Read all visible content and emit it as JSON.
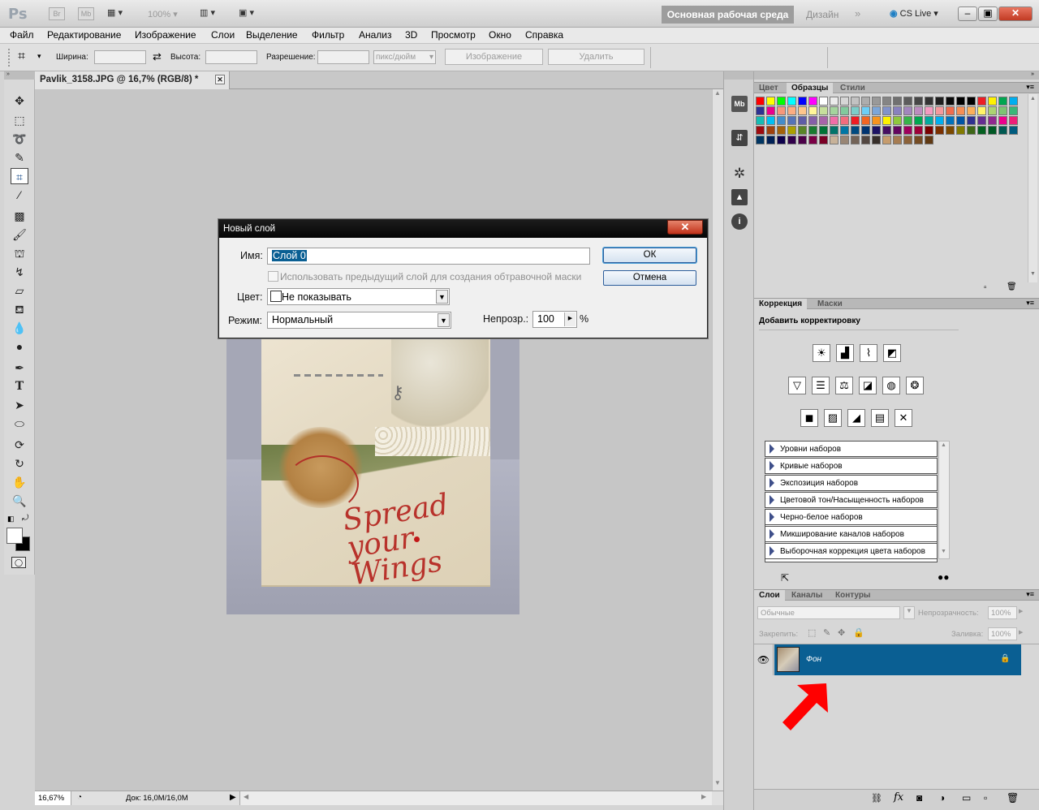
{
  "app": {
    "logo": "Ps",
    "bridge": "Br",
    "mini_bridge": "Mb",
    "zoom": "100%",
    "workspace": "Основная рабочая среда",
    "design": "Дизайн",
    "cs_live": "CS Live"
  },
  "menu": [
    "Файл",
    "Редактирование",
    "Изображение",
    "Слои",
    "Выделение",
    "Фильтр",
    "Анализ",
    "3D",
    "Просмотр",
    "Окно",
    "Справка"
  ],
  "options": {
    "width_label": "Ширина:",
    "height_label": "Высота:",
    "resolution_label": "Разрешение:",
    "unit": "пикс/дюйм",
    "image_button": "Изображение",
    "delete_button": "Удалить"
  },
  "document": {
    "tab_title": "Pavlik_3158.JPG @ 16,7% (RGB/8) *",
    "zoom_value": "16,67%",
    "doc_info": "Док: 16,0M/16,0M"
  },
  "dialog": {
    "title": "Новый слой",
    "name_label": "Имя:",
    "name_value": "Слой 0",
    "clip_mask_label": "Использовать предыдущий слой для создания обтравочной маски",
    "color_label": "Цвет:",
    "color_value": "Не показывать",
    "mode_label": "Режим:",
    "mode_value": "Нормальный",
    "opacity_label": "Непрозр.:",
    "opacity_value": "100",
    "opacity_unit": "%",
    "ok": "ОК",
    "cancel": "Отмена"
  },
  "swatches_panel": {
    "tabs": [
      "Цвет",
      "Образцы",
      "Стили"
    ],
    "colors": [
      "#ff0000",
      "#ffff00",
      "#00ff00",
      "#00ffff",
      "#0000ff",
      "#ff00ff",
      "#ffffff",
      "#ebebeb",
      "#d6d6d6",
      "#c2c2c2",
      "#adadad",
      "#999999",
      "#858585",
      "#707070",
      "#5c5c5c",
      "#474747",
      "#333333",
      "#1f1f1f",
      "#0a0a0a",
      "#000000",
      "#000000",
      "#ee1d24",
      "#fff200",
      "#00a650",
      "#00aeef",
      "#2e3192",
      "#ec008c",
      "#f7977a",
      "#fbad82",
      "#fdc68c",
      "#fff799",
      "#c6df9c",
      "#a4d49d",
      "#81ca9d",
      "#7bcdc9",
      "#6ccff7",
      "#7ca6d8",
      "#8293ca",
      "#8881be",
      "#a286bd",
      "#bc8cbf",
      "#f49bc1",
      "#f5999d",
      "#f16c4d",
      "#f68e54",
      "#fbaf5a",
      "#fff467",
      "#acd372",
      "#7dc473",
      "#39b778",
      "#16bcb4",
      "#00bff3",
      "#438ccb",
      "#5573b7",
      "#5e5ca7",
      "#855fa8",
      "#a763a9",
      "#ef6ea8",
      "#f16d7e",
      "#ee1d24",
      "#f16522",
      "#f7941d",
      "#fff100",
      "#8fc63d",
      "#37b449",
      "#00a650",
      "#00a99e",
      "#00aeef",
      "#0072bc",
      "#0054a5",
      "#2f3090",
      "#652d91",
      "#91278f",
      "#ec008c",
      "#ed1e79",
      "#9e0b0f",
      "#a0410d",
      "#a3620a",
      "#aba000",
      "#588528",
      "#197b30",
      "#007236",
      "#00736a",
      "#0076a4",
      "#004a80",
      "#003370",
      "#1d1363",
      "#450e61",
      "#62055f",
      "#9e005c",
      "#9d0039",
      "#790000",
      "#7b3000",
      "#7c4900",
      "#827a00",
      "#3e6617",
      "#045f20",
      "#005824",
      "#005951",
      "#005b7e",
      "#003562",
      "#002056",
      "#0c004b",
      "#30004a",
      "#4b0048",
      "#7a0045",
      "#7a0026",
      "#c7b299",
      "#998675",
      "#736357",
      "#534741",
      "#372f2a",
      "#c69c6d",
      "#a67c52",
      "#8c6239",
      "#754c24",
      "#603913"
    ]
  },
  "adjustments_panel": {
    "tabs": [
      "Коррекция",
      "Маски"
    ],
    "heading": "Добавить корректировку",
    "presets": [
      "Уровни наборов",
      "Кривые наборов",
      "Экспозиция наборов",
      "Цветовой тон/Насыщенность наборов",
      "Черно-белое наборов",
      "Микширование каналов наборов",
      "Выборочная коррекция цвета наборов"
    ]
  },
  "layers_panel": {
    "tabs": [
      "Слои",
      "Каналы",
      "Контуры"
    ],
    "blend_mode": "Обычные",
    "opacity_label": "Непрозрачность:",
    "opacity_value": "100%",
    "lock_label": "Закрепить:",
    "fill_label": "Заливка:",
    "fill_value": "100%",
    "layer_name": "Фон",
    "selection_color": "#0a5f93"
  },
  "annotation": {
    "arrow_color": "#ff0000"
  },
  "artwork_text": "Spread your Wings"
}
